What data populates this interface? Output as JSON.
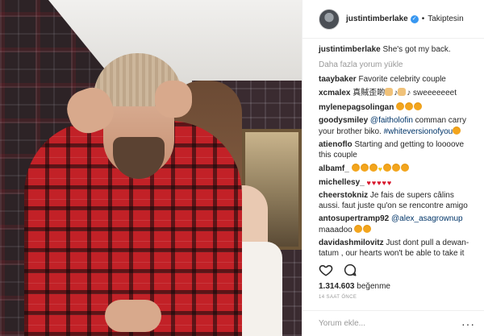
{
  "post": {
    "username": "justintimberlake",
    "verified_icon": "verified-badge-icon",
    "follow_status": "Takiptesin",
    "caption_user": "justintimberlake",
    "caption_text": "She's got my back.",
    "load_more": "Daha fazla yorum yükle",
    "likes_count": "1.314.603",
    "likes_label": "beğenme",
    "timestamp": "14 SAAT ÖNCE",
    "add_comment_placeholder": "Yorum ekle...",
    "more_options": "···"
  },
  "comments": [
    {
      "user": "taaybaker",
      "text": "Favorite celebrity couple"
    },
    {
      "user": "xcmalex",
      "text": "真賊歪啲",
      "emoji": [
        "person-icon",
        "note",
        "person-icon",
        "note"
      ],
      "tail": " sweeeeeeet"
    },
    {
      "user": "mylenepagsolingan",
      "emoji": [
        "heart-eyes",
        "heart-eyes",
        "heart-eyes"
      ]
    },
    {
      "user": "goodysmiley",
      "mention": "@faitholofin",
      "text": " comman carry your brother biko. ",
      "hashtag": "#whiteversionofyou",
      "emoji": [
        "laugh"
      ]
    },
    {
      "user": "atienoflo",
      "text": "Starting and getting to loooove this couple"
    },
    {
      "user": "albamf_",
      "emoji": [
        "heart-eyes",
        "heart-eyes",
        "heart-eyes",
        "yellow-heart",
        "heart-eyes",
        "heart-eyes",
        "heart-eyes"
      ]
    },
    {
      "user": "michellesy_",
      "emoji": [
        "red-heart",
        "red-heart",
        "red-heart",
        "red-heart",
        "red-heart"
      ]
    },
    {
      "user": "cheerstokniz",
      "text": "Je fais de supers câlins aussi. faut juste qu'on se rencontre amigo"
    },
    {
      "user": "antosupertramp92",
      "mention": "@alex_asagrownup",
      "tail": " maaadoo",
      "emoji": [
        "heart-eyes",
        "laugh"
      ]
    },
    {
      "user": "davidashmilovitz",
      "text": "Just dont pull a dewan-tatum , our hearts won't be able to take it"
    }
  ],
  "icons": {
    "like": "heart-outline-icon",
    "comment": "comment-bubble-icon"
  },
  "colors": {
    "verified": "#3897f0",
    "secondary_text": "#999999",
    "mention": "#003569",
    "divider": "#efefef"
  }
}
